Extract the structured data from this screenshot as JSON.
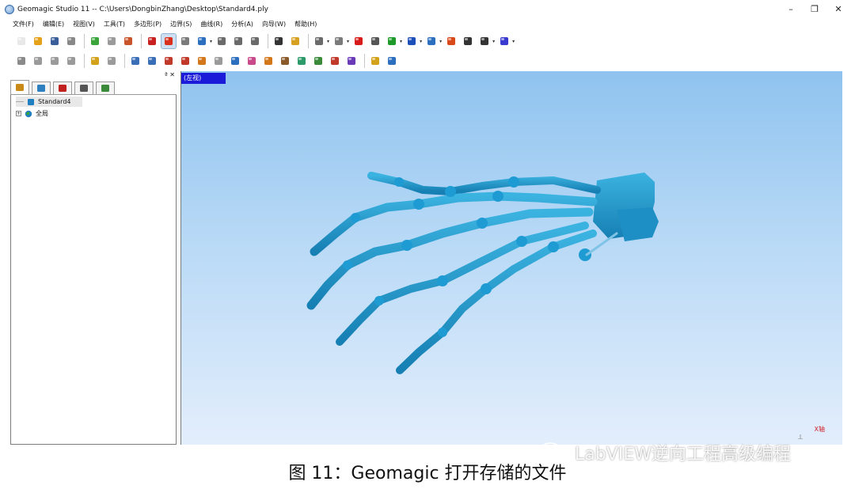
{
  "window": {
    "title": "Geomagic Studio 11 -- C:\\Users\\DongbinZhang\\Desktop\\Standard4.ply",
    "minimize": "–",
    "restore": "❐",
    "close": "✕"
  },
  "menu": [
    "文件(F)",
    "编辑(E)",
    "视图(V)",
    "工具(T)",
    "多边形(P)",
    "边界(S)",
    "曲线(R)",
    "分析(A)",
    "向导(W)",
    "帮助(H)"
  ],
  "toolbar1": [
    {
      "name": "new-file-icon",
      "color": "#e8e8e8"
    },
    {
      "name": "open-icon",
      "color": "#e3a21a"
    },
    {
      "name": "save-icon",
      "color": "#3a5e9a"
    },
    {
      "name": "print-icon",
      "color": "#888888"
    },
    {
      "sep": true
    },
    {
      "name": "points-icon",
      "color": "#3aa33a"
    },
    {
      "name": "cube-icon",
      "color": "#9a9a9a"
    },
    {
      "name": "polygon-icon",
      "color": "#c9542a"
    },
    {
      "sep": true
    },
    {
      "name": "sphere-red-icon",
      "color": "#c8201e"
    },
    {
      "name": "sphere-pressed-icon",
      "color": "#d8301c",
      "pressed": true
    },
    {
      "name": "spin-icon",
      "color": "#7a7a7a"
    },
    {
      "name": "rotate-icon",
      "color": "#2d6fbf",
      "drop": true
    },
    {
      "name": "zoom-in-icon",
      "color": "#6a6a6a"
    },
    {
      "name": "zoom-out-icon",
      "color": "#6a6a6a"
    },
    {
      "name": "zoom-window-icon",
      "color": "#6a6a6a"
    },
    {
      "sep": true
    },
    {
      "name": "camera-icon",
      "color": "#333333"
    },
    {
      "name": "pencil-icon",
      "color": "#d6a020"
    },
    {
      "sep": true
    },
    {
      "name": "lasso-icon",
      "color": "#6a6a6a",
      "drop": true
    },
    {
      "name": "mesh-icon",
      "color": "#7a7a7a",
      "drop": true
    },
    {
      "name": "record-icon",
      "color": "#d91a1a"
    },
    {
      "name": "stop-icon",
      "color": "#555555"
    },
    {
      "name": "play-icon",
      "color": "#1e9a2a",
      "drop": true
    },
    {
      "name": "plane-icon",
      "color": "#1d4fb8",
      "drop": true
    },
    {
      "name": "box-view-icon",
      "color": "#2d6fbf",
      "drop": true
    },
    {
      "name": "shading-icon",
      "color": "#d84a1a"
    },
    {
      "name": "select-icon",
      "color": "#333333"
    },
    {
      "name": "rect-select-icon",
      "color": "#333333",
      "drop": true
    },
    {
      "name": "gem-icon",
      "color": "#3a3ad0",
      "drop": true
    }
  ],
  "toolbar2": [
    {
      "name": "delete-icon",
      "color": "#8a8a8a"
    },
    {
      "name": "scatter-icon",
      "color": "#9a9a9a"
    },
    {
      "name": "noise-icon",
      "color": "#9a9a9a"
    },
    {
      "name": "smooth-icon",
      "color": "#9a9a9a"
    },
    {
      "sep": true
    },
    {
      "name": "shape-icon",
      "color": "#d2a31a"
    },
    {
      "name": "clear-icon",
      "color": "#9a9a9a"
    },
    {
      "sep": true
    },
    {
      "name": "fill-holes-icon",
      "color": "#3a6fb8"
    },
    {
      "name": "wrap-icon",
      "color": "#3a6fb8"
    },
    {
      "name": "merge-icon",
      "color": "#c0392b"
    },
    {
      "name": "decimate-icon",
      "color": "#c0392b"
    },
    {
      "name": "refine-icon",
      "color": "#d2771a"
    },
    {
      "name": "relax-icon",
      "color": "#9a9a9a"
    },
    {
      "name": "sharpen-icon",
      "color": "#2d6fbf"
    },
    {
      "name": "offset-icon",
      "color": "#c94a8a"
    },
    {
      "name": "thicken-icon",
      "color": "#d2771a"
    },
    {
      "name": "trim-icon",
      "color": "#8a5a2a"
    },
    {
      "name": "triangle-icon",
      "color": "#2d9a6a"
    },
    {
      "name": "peak-icon",
      "color": "#3a8a3a"
    },
    {
      "name": "red-block-icon",
      "color": "#c0392b"
    },
    {
      "name": "purple-gem-icon",
      "color": "#6a3ab8"
    },
    {
      "sep": true
    },
    {
      "name": "stack-icon",
      "color": "#d2a31a"
    },
    {
      "name": "wave-icon",
      "color": "#2d6fbf"
    }
  ],
  "pane": {
    "controls": "ª ✕",
    "tabs": [
      {
        "name": "tab-model-manager",
        "color": "#c98a1a",
        "active": true
      },
      {
        "name": "tab-display",
        "color": "#2d7fbf"
      },
      {
        "name": "tab-dialog",
        "color": "#c0201e"
      },
      {
        "name": "tab-console",
        "color": "#555555"
      },
      {
        "name": "tab-grid",
        "color": "#3a8a3a"
      }
    ],
    "tree": [
      {
        "label": "Standard4",
        "icon_color": "#1f7fbf",
        "expander": ""
      },
      {
        "label": "全局",
        "icon_color": "#1f7fbf",
        "expander": "+"
      }
    ]
  },
  "viewport": {
    "view_label": "(左视)",
    "axis_label": "X轴",
    "model_color": "#2a9fd2"
  },
  "caption": "图 11：Geomagic 打开存储的文件",
  "watermark": "LabVIEW逆向工程高级编程"
}
